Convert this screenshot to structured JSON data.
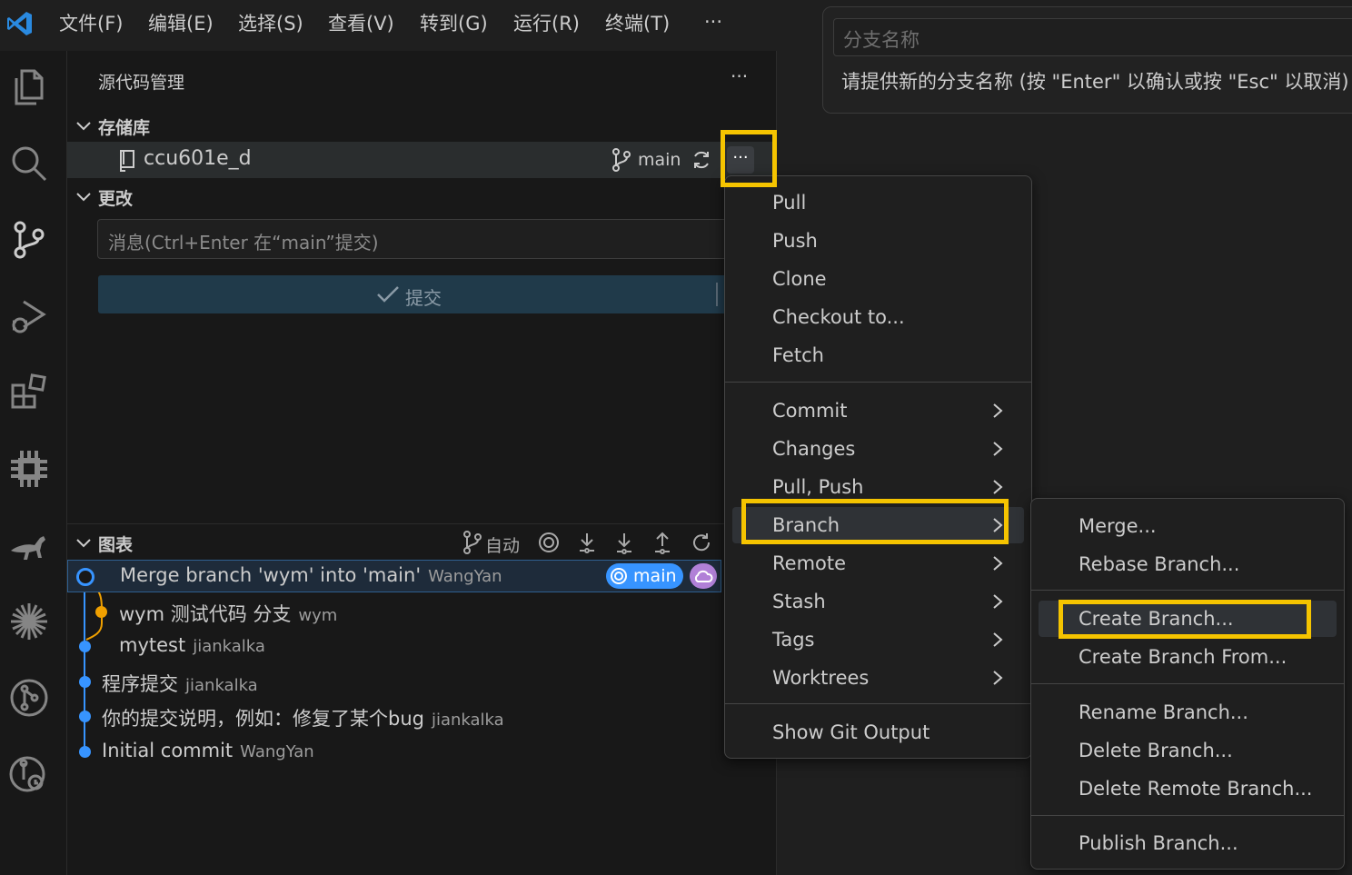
{
  "menubar": {
    "items": [
      "文件(F)",
      "编辑(E)",
      "选择(S)",
      "查看(V)",
      "转到(G)",
      "运行(R)",
      "终端(T)",
      "···"
    ]
  },
  "quick_input": {
    "placeholder": "分支名称",
    "message": "请提供新的分支名称 (按 \"Enter\" 以确认或按 \"Esc\" 以取消)"
  },
  "sidebar": {
    "title": "源代码管理",
    "more": "···",
    "repositories_header": "存储库",
    "repo_name": "ccu601e_d",
    "repo_branch": "main",
    "changes_header": "更改",
    "commit_placeholder": "消息(Ctrl+Enter 在“main”提交)",
    "commit_button": "提交",
    "graph_header": "图表",
    "graph_auto": "自动"
  },
  "graph": {
    "commits": [
      {
        "message": "Merge branch 'wym' into 'main'",
        "author": "WangYan",
        "badge": "main"
      },
      {
        "message": "wym 测试代码  分支",
        "author": "wym"
      },
      {
        "message": "mytest",
        "author": "jiankalka"
      },
      {
        "message": "程序提交",
        "author": "jiankalka"
      },
      {
        "message": "你的提交说明，例如：修复了某个bug",
        "author": "jiankalka"
      },
      {
        "message": "Initial commit",
        "author": "WangYan"
      }
    ]
  },
  "context_menu": {
    "group1": [
      "Pull",
      "Push",
      "Clone",
      "Checkout to...",
      "Fetch"
    ],
    "group2": [
      "Commit",
      "Changes",
      "Pull, Push",
      "Branch",
      "Remote",
      "Stash",
      "Tags",
      "Worktrees"
    ],
    "group3": [
      "Show Git Output"
    ]
  },
  "branch_submenu": {
    "group1": [
      "Merge...",
      "Rebase Branch..."
    ],
    "group2": [
      "Create Branch...",
      "Create Branch From..."
    ],
    "group3": [
      "Rename Branch...",
      "Delete Branch...",
      "Delete Remote Branch..."
    ],
    "group4": [
      "Publish Branch..."
    ]
  },
  "colors": {
    "highlight": "#f5c400",
    "graph_blue": "#3794ff",
    "graph_orange": "#f0a000",
    "cloud_badge": "#b180d7"
  }
}
